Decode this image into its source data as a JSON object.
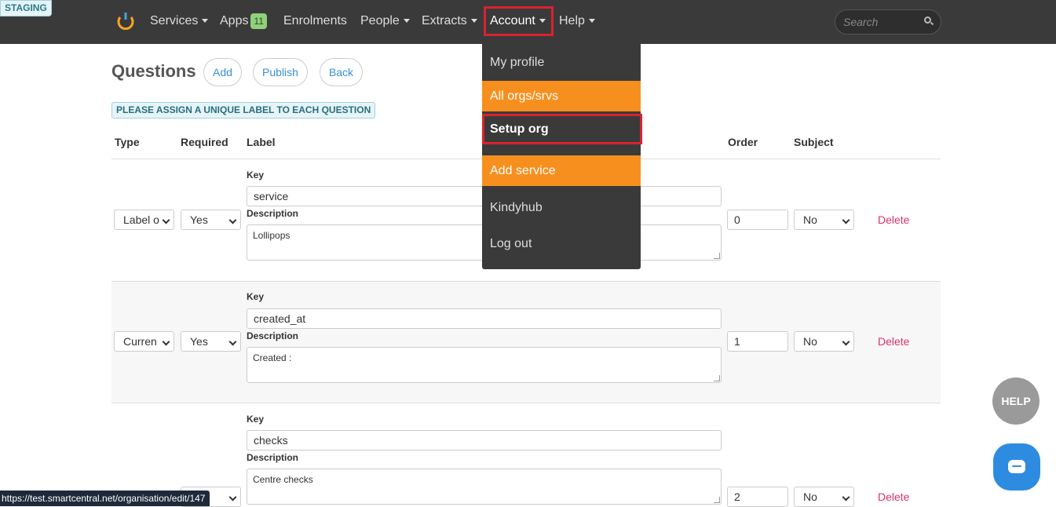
{
  "env_badge": "STAGING",
  "nav": {
    "services": "Services",
    "apps": "Apps",
    "apps_count": "11",
    "enrolments": "Enrolments",
    "people": "People",
    "extracts": "Extracts",
    "account": "Account",
    "help": "Help",
    "search_placeholder": "Search"
  },
  "page": {
    "title": "Questions",
    "add": "Add",
    "publish": "Publish",
    "back": "Back",
    "notice": "PLEASE ASSIGN A UNIQUE LABEL TO EACH QUESTION"
  },
  "table": {
    "headers": {
      "type": "Type",
      "required": "Required",
      "label": "Label",
      "order": "Order",
      "subject": "Subject"
    },
    "key_label": "Key",
    "description_label": "Description",
    "delete_label": "Delete",
    "rows": [
      {
        "type": "Label o",
        "required": "Yes",
        "key": "service",
        "description": "Lollipops",
        "order": "0",
        "subject": "No"
      },
      {
        "type": "Curren",
        "required": "Yes",
        "key": "created_at",
        "description": "Created :",
        "order": "1",
        "subject": "No"
      },
      {
        "type": "",
        "required": "",
        "key": "checks",
        "description": "Centre checks",
        "order": "2",
        "subject": "No"
      }
    ]
  },
  "account_menu": {
    "items": [
      "My profile",
      "All orgs/srvs",
      "Setup org",
      "Add service",
      "Kindyhub",
      "Log out"
    ]
  },
  "status_url": "https://test.smartcentral.net/organisation/edit/147",
  "help_button": "HELP",
  "colors": {
    "nav_bg": "#3a3a3a",
    "orange": "#f78f1e",
    "highlight": "#d9232f",
    "link": "#3a8fd6",
    "delete": "#d9336b"
  }
}
